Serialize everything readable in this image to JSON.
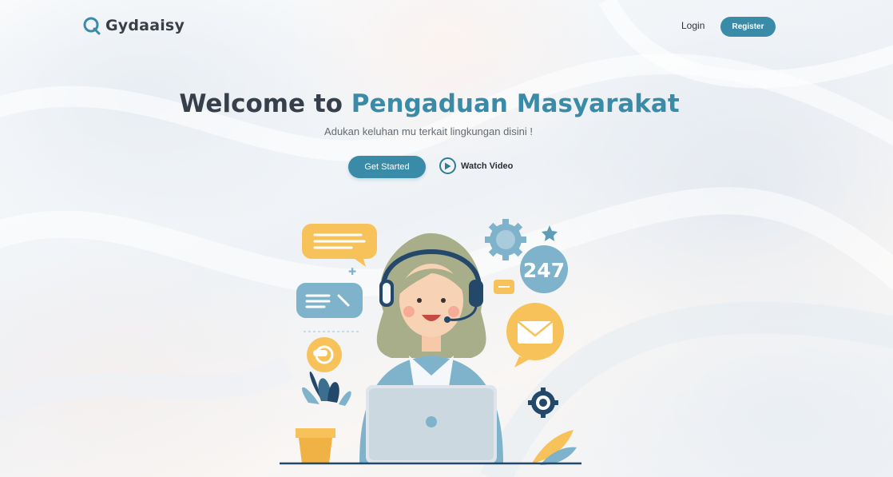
{
  "header": {
    "brand": "Gydaaisy",
    "login_label": "Login",
    "register_label": "Register"
  },
  "hero": {
    "title_prefix": "Welcome to ",
    "title_accent": "Pengaduan Masyarakat",
    "subtitle": "Adukan keluhan mu terkait lingkungan disini !",
    "get_started_label": "Get Started",
    "watch_video_label": "Watch Video"
  },
  "illustration": {
    "badge_text": "247"
  },
  "colors": {
    "primary": "#3a8ba8",
    "heading": "#37404a",
    "accent_yellow": "#f7c25a",
    "accent_blue": "#7fb3cc"
  },
  "icons": [
    "logo-q-icon",
    "play-icon",
    "chat-bubble-icon",
    "gear-icon",
    "mail-icon",
    "star-icon",
    "plant-icon",
    "laptop-icon",
    "headset-icon"
  ]
}
